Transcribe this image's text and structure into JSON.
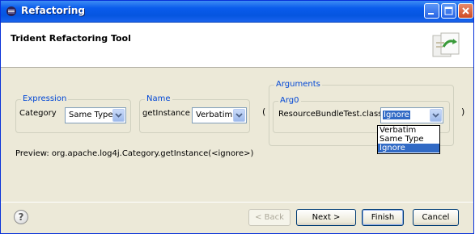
{
  "window": {
    "title": "Refactoring"
  },
  "header": {
    "title": "Trident Refactoring Tool"
  },
  "expression": {
    "legend": "Expression",
    "label": "Category",
    "combo_value": "Same Type"
  },
  "name": {
    "legend": "Name",
    "label": "getInstance",
    "combo_value": "Verbatim"
  },
  "arguments": {
    "legend": "Arguments",
    "arg0": {
      "legend": "Arg0",
      "label": "ResourceBundleTest.class",
      "combo_value": "Ignore",
      "options": [
        "Verbatim",
        "Same Type",
        "Ignore"
      ],
      "selected_index": 2
    }
  },
  "parens": {
    "open": "(",
    "close": ")"
  },
  "preview": {
    "text": "Preview:  org.apache.log4j.Category.getInstance(<ignore>)"
  },
  "footer": {
    "back": "< Back",
    "next": "Next >",
    "finish": "Finish",
    "cancel": "Cancel"
  },
  "icons": {
    "title": "eclipse-icon",
    "header": "refactor-wizard-icon",
    "help": "help-icon"
  },
  "colors": {
    "titlebar": "#0a5cec",
    "legend": "#0046d5",
    "selection": "#316ac5"
  }
}
